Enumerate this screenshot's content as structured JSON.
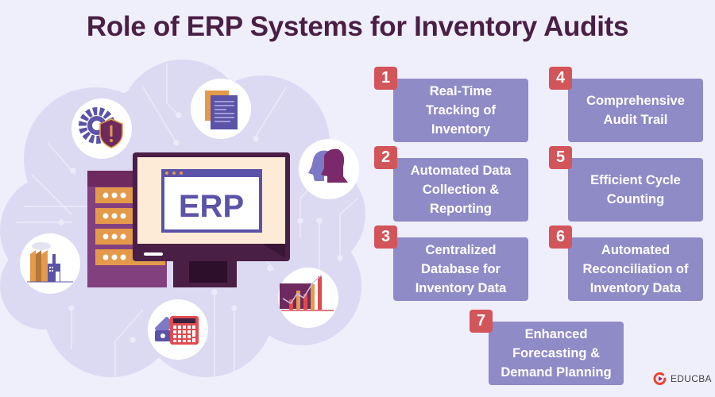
{
  "title": "Role of ERP Systems for Inventory Audits",
  "illustration": {
    "screen_label": "ERP",
    "icons": [
      "gear-shield-icon",
      "documents-icon",
      "heads-icon",
      "factory-icon",
      "money-calculator-icon",
      "growth-chart-icon",
      "server-icon",
      "monitor-icon"
    ]
  },
  "items": [
    {
      "number": "1",
      "label": "Real-Time\nTracking of\nInventory"
    },
    {
      "number": "2",
      "label": "Automated Data\nCollection &\nReporting"
    },
    {
      "number": "3",
      "label": "Centralized\nDatabase for\nInventory Data"
    },
    {
      "number": "4",
      "label": "Comprehensive\nAudit Trail"
    },
    {
      "number": "5",
      "label": "Efficient Cycle\nCounting"
    },
    {
      "number": "6",
      "label": "Automated\nReconciliation of\nInventory Data"
    },
    {
      "number": "7",
      "label": "Enhanced\nForecasting &\nDemand Planning"
    }
  ],
  "brand": {
    "name": "EDUCBA"
  },
  "colors": {
    "title": "#4a1f45",
    "card": "#8f8bc7",
    "badge": "#d2555a",
    "background": "#efeefb"
  }
}
